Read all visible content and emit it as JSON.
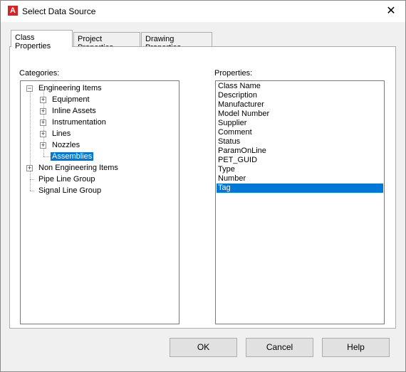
{
  "window": {
    "title": "Select Data Source",
    "app_icon_letter": "A"
  },
  "tabs": [
    {
      "label": "Class Properties"
    },
    {
      "label": "Project Properties"
    },
    {
      "label": "Drawing Properties"
    }
  ],
  "categories": {
    "label": "Categories:",
    "tree": [
      {
        "label": "Engineering Items"
      },
      {
        "label": "Equipment"
      },
      {
        "label": "Inline Assets"
      },
      {
        "label": "Instrumentation"
      },
      {
        "label": "Lines"
      },
      {
        "label": "Nozzles"
      },
      {
        "label": "Assemblies"
      },
      {
        "label": "Non Engineering Items"
      },
      {
        "label": "Pipe Line Group"
      },
      {
        "label": "Signal Line Group"
      }
    ],
    "expand_sign": "+",
    "collapse_sign": "−"
  },
  "properties": {
    "label": "Properties:",
    "items": [
      "Class Name",
      "Description",
      "Manufacturer",
      "Model Number",
      "Supplier",
      "Comment",
      "Status",
      "ParamOnLine",
      "PET_GUID",
      "Type",
      "Number",
      "Tag"
    ],
    "selected": "Tag"
  },
  "buttons": {
    "ok": "OK",
    "cancel": "Cancel",
    "help": "Help"
  },
  "close_glyph": "✕",
  "colors": {
    "selection": "#0078d7",
    "brand_icon": "#d42426"
  }
}
